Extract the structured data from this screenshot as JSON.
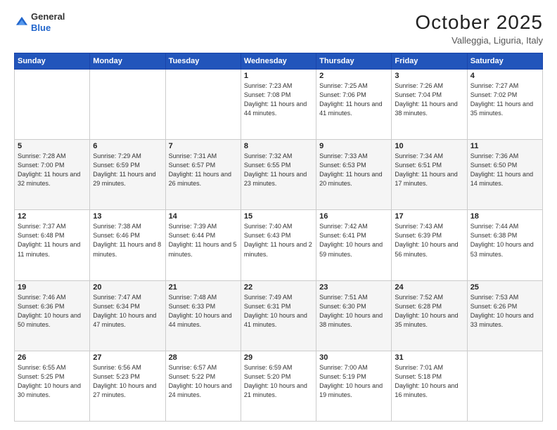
{
  "header": {
    "logo_line1": "General",
    "logo_line2": "Blue",
    "month": "October 2025",
    "location": "Valleggia, Liguria, Italy"
  },
  "weekdays": [
    "Sunday",
    "Monday",
    "Tuesday",
    "Wednesday",
    "Thursday",
    "Friday",
    "Saturday"
  ],
  "weeks": [
    [
      {
        "day": "",
        "info": ""
      },
      {
        "day": "",
        "info": ""
      },
      {
        "day": "",
        "info": ""
      },
      {
        "day": "1",
        "info": "Sunrise: 7:23 AM\nSunset: 7:08 PM\nDaylight: 11 hours and 44 minutes."
      },
      {
        "day": "2",
        "info": "Sunrise: 7:25 AM\nSunset: 7:06 PM\nDaylight: 11 hours and 41 minutes."
      },
      {
        "day": "3",
        "info": "Sunrise: 7:26 AM\nSunset: 7:04 PM\nDaylight: 11 hours and 38 minutes."
      },
      {
        "day": "4",
        "info": "Sunrise: 7:27 AM\nSunset: 7:02 PM\nDaylight: 11 hours and 35 minutes."
      }
    ],
    [
      {
        "day": "5",
        "info": "Sunrise: 7:28 AM\nSunset: 7:00 PM\nDaylight: 11 hours and 32 minutes."
      },
      {
        "day": "6",
        "info": "Sunrise: 7:29 AM\nSunset: 6:59 PM\nDaylight: 11 hours and 29 minutes."
      },
      {
        "day": "7",
        "info": "Sunrise: 7:31 AM\nSunset: 6:57 PM\nDaylight: 11 hours and 26 minutes."
      },
      {
        "day": "8",
        "info": "Sunrise: 7:32 AM\nSunset: 6:55 PM\nDaylight: 11 hours and 23 minutes."
      },
      {
        "day": "9",
        "info": "Sunrise: 7:33 AM\nSunset: 6:53 PM\nDaylight: 11 hours and 20 minutes."
      },
      {
        "day": "10",
        "info": "Sunrise: 7:34 AM\nSunset: 6:51 PM\nDaylight: 11 hours and 17 minutes."
      },
      {
        "day": "11",
        "info": "Sunrise: 7:36 AM\nSunset: 6:50 PM\nDaylight: 11 hours and 14 minutes."
      }
    ],
    [
      {
        "day": "12",
        "info": "Sunrise: 7:37 AM\nSunset: 6:48 PM\nDaylight: 11 hours and 11 minutes."
      },
      {
        "day": "13",
        "info": "Sunrise: 7:38 AM\nSunset: 6:46 PM\nDaylight: 11 hours and 8 minutes."
      },
      {
        "day": "14",
        "info": "Sunrise: 7:39 AM\nSunset: 6:44 PM\nDaylight: 11 hours and 5 minutes."
      },
      {
        "day": "15",
        "info": "Sunrise: 7:40 AM\nSunset: 6:43 PM\nDaylight: 11 hours and 2 minutes."
      },
      {
        "day": "16",
        "info": "Sunrise: 7:42 AM\nSunset: 6:41 PM\nDaylight: 10 hours and 59 minutes."
      },
      {
        "day": "17",
        "info": "Sunrise: 7:43 AM\nSunset: 6:39 PM\nDaylight: 10 hours and 56 minutes."
      },
      {
        "day": "18",
        "info": "Sunrise: 7:44 AM\nSunset: 6:38 PM\nDaylight: 10 hours and 53 minutes."
      }
    ],
    [
      {
        "day": "19",
        "info": "Sunrise: 7:46 AM\nSunset: 6:36 PM\nDaylight: 10 hours and 50 minutes."
      },
      {
        "day": "20",
        "info": "Sunrise: 7:47 AM\nSunset: 6:34 PM\nDaylight: 10 hours and 47 minutes."
      },
      {
        "day": "21",
        "info": "Sunrise: 7:48 AM\nSunset: 6:33 PM\nDaylight: 10 hours and 44 minutes."
      },
      {
        "day": "22",
        "info": "Sunrise: 7:49 AM\nSunset: 6:31 PM\nDaylight: 10 hours and 41 minutes."
      },
      {
        "day": "23",
        "info": "Sunrise: 7:51 AM\nSunset: 6:30 PM\nDaylight: 10 hours and 38 minutes."
      },
      {
        "day": "24",
        "info": "Sunrise: 7:52 AM\nSunset: 6:28 PM\nDaylight: 10 hours and 35 minutes."
      },
      {
        "day": "25",
        "info": "Sunrise: 7:53 AM\nSunset: 6:26 PM\nDaylight: 10 hours and 33 minutes."
      }
    ],
    [
      {
        "day": "26",
        "info": "Sunrise: 6:55 AM\nSunset: 5:25 PM\nDaylight: 10 hours and 30 minutes."
      },
      {
        "day": "27",
        "info": "Sunrise: 6:56 AM\nSunset: 5:23 PM\nDaylight: 10 hours and 27 minutes."
      },
      {
        "day": "28",
        "info": "Sunrise: 6:57 AM\nSunset: 5:22 PM\nDaylight: 10 hours and 24 minutes."
      },
      {
        "day": "29",
        "info": "Sunrise: 6:59 AM\nSunset: 5:20 PM\nDaylight: 10 hours and 21 minutes."
      },
      {
        "day": "30",
        "info": "Sunrise: 7:00 AM\nSunset: 5:19 PM\nDaylight: 10 hours and 19 minutes."
      },
      {
        "day": "31",
        "info": "Sunrise: 7:01 AM\nSunset: 5:18 PM\nDaylight: 10 hours and 16 minutes."
      },
      {
        "day": "",
        "info": ""
      }
    ]
  ]
}
